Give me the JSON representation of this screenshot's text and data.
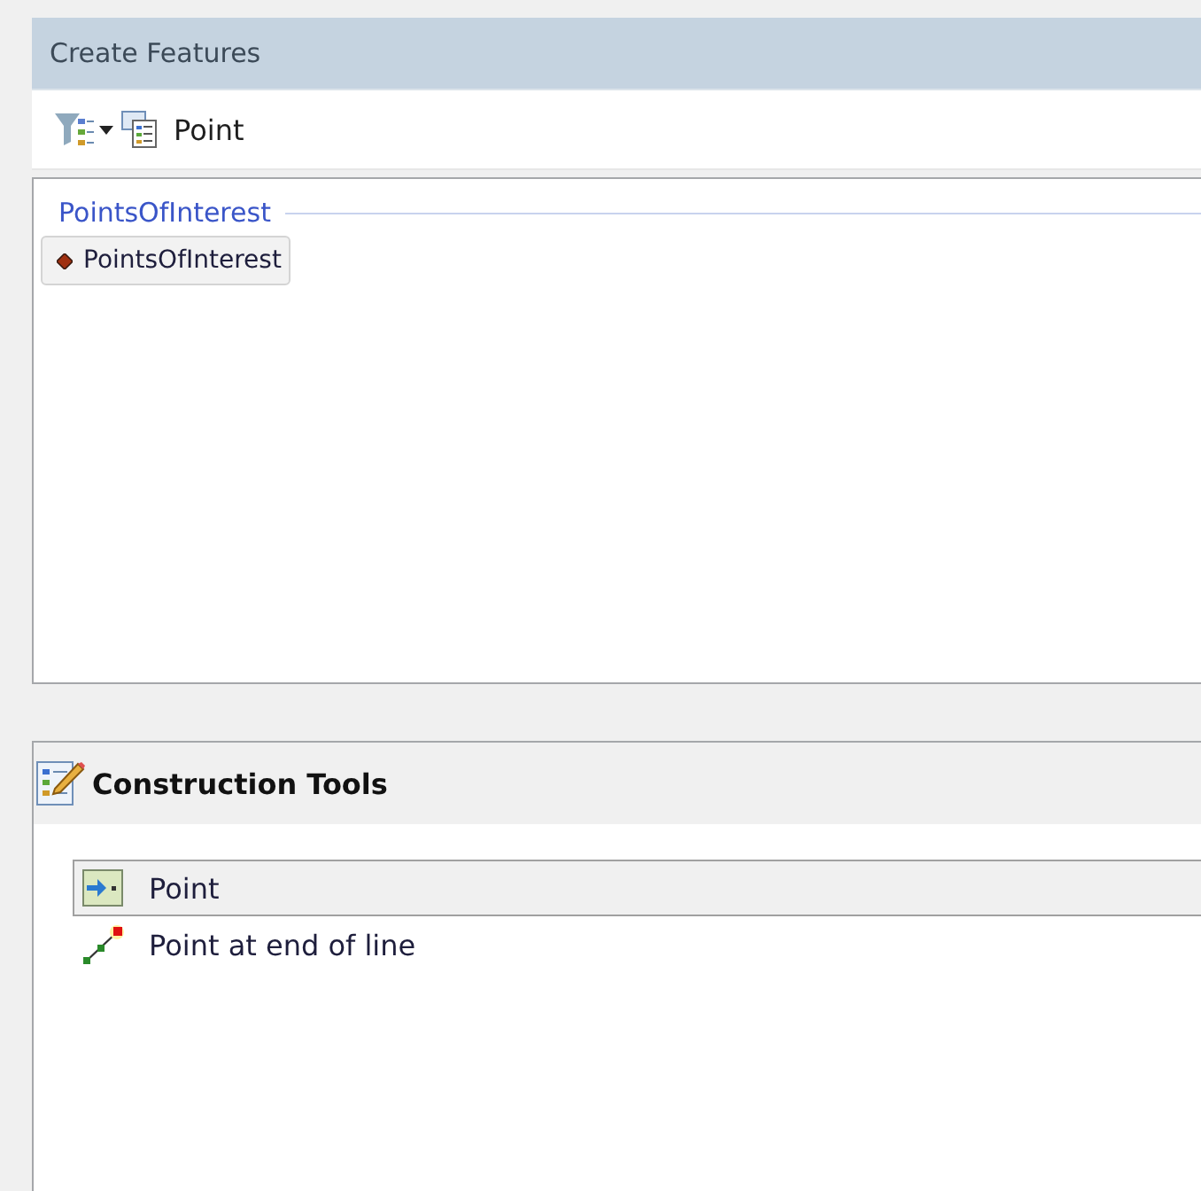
{
  "window": {
    "title": "Create Features"
  },
  "toolbar": {
    "filter_label": "Point"
  },
  "template_groups": [
    {
      "name": "PointsOfInterest",
      "items": [
        {
          "label": "PointsOfInterest",
          "selected": true
        }
      ]
    }
  ],
  "construction_tools": {
    "title": "Construction Tools",
    "tools": [
      {
        "label": "Point",
        "kind": "point",
        "selected": true
      },
      {
        "label": "Point at end of line",
        "kind": "line_end",
        "selected": false
      }
    ]
  }
}
